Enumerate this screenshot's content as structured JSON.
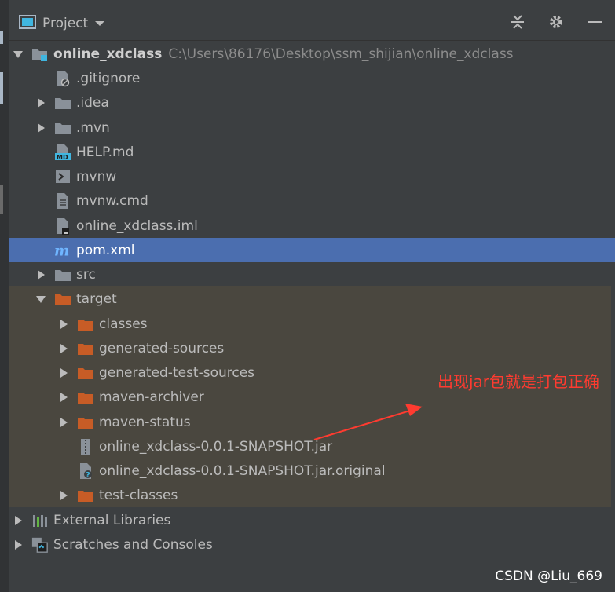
{
  "header": {
    "title": "Project",
    "icons": [
      "project-view-icon",
      "dropdown-icon",
      "collapse-all-icon",
      "gear-icon",
      "minimize-icon"
    ]
  },
  "tree": [
    {
      "label": "online_xdclass",
      "path": "C:\\Users\\86176\\Desktop\\ssm_shijian\\online_xdclass",
      "icon": "module-folder-icon",
      "state": "expanded",
      "bold": true
    },
    {
      "label": ".gitignore",
      "icon": "ignore-file-icon",
      "state": "leaf"
    },
    {
      "label": ".idea",
      "icon": "folder-icon",
      "state": "collapsed"
    },
    {
      "label": ".mvn",
      "icon": "folder-icon",
      "state": "collapsed"
    },
    {
      "label": "HELP.md",
      "icon": "markdown-file-icon",
      "state": "leaf"
    },
    {
      "label": "mvnw",
      "icon": "shell-script-icon",
      "state": "leaf"
    },
    {
      "label": "mvnw.cmd",
      "icon": "text-file-icon",
      "state": "leaf"
    },
    {
      "label": "online_xdclass.iml",
      "icon": "iml-file-icon",
      "state": "leaf"
    },
    {
      "label": "pom.xml",
      "icon": "maven-icon",
      "state": "leaf",
      "selected": true
    },
    {
      "label": "src",
      "icon": "folder-icon",
      "state": "collapsed"
    },
    {
      "label": "target",
      "icon": "excluded-folder-icon",
      "state": "expanded"
    },
    {
      "label": "classes",
      "icon": "excluded-folder-icon",
      "state": "collapsed"
    },
    {
      "label": "generated-sources",
      "icon": "excluded-folder-icon",
      "state": "collapsed"
    },
    {
      "label": "generated-test-sources",
      "icon": "excluded-folder-icon",
      "state": "collapsed"
    },
    {
      "label": "maven-archiver",
      "icon": "excluded-folder-icon",
      "state": "collapsed"
    },
    {
      "label": "maven-status",
      "icon": "excluded-folder-icon",
      "state": "collapsed"
    },
    {
      "label": "online_xdclass-0.0.1-SNAPSHOT.jar",
      "icon": "jar-file-icon",
      "state": "leaf"
    },
    {
      "label": "online_xdclass-0.0.1-SNAPSHOT.jar.original",
      "icon": "unknown-file-icon",
      "state": "leaf"
    },
    {
      "label": "test-classes",
      "icon": "excluded-folder-icon",
      "state": "collapsed"
    },
    {
      "label": "External Libraries",
      "icon": "libraries-icon",
      "state": "collapsed"
    },
    {
      "label": "Scratches and Consoles",
      "icon": "scratches-icon",
      "state": "collapsed"
    }
  ],
  "annotation": {
    "text": "出现jar包就是打包正确"
  },
  "watermark": "CSDN @Liu_669",
  "colors": {
    "background": "#3c3f41",
    "selection": "#4b6eaf",
    "excluded": "#4a473f",
    "folder": "#8a9199",
    "excludedFolder": "#c75c26",
    "annotation": "#ff3b30"
  }
}
